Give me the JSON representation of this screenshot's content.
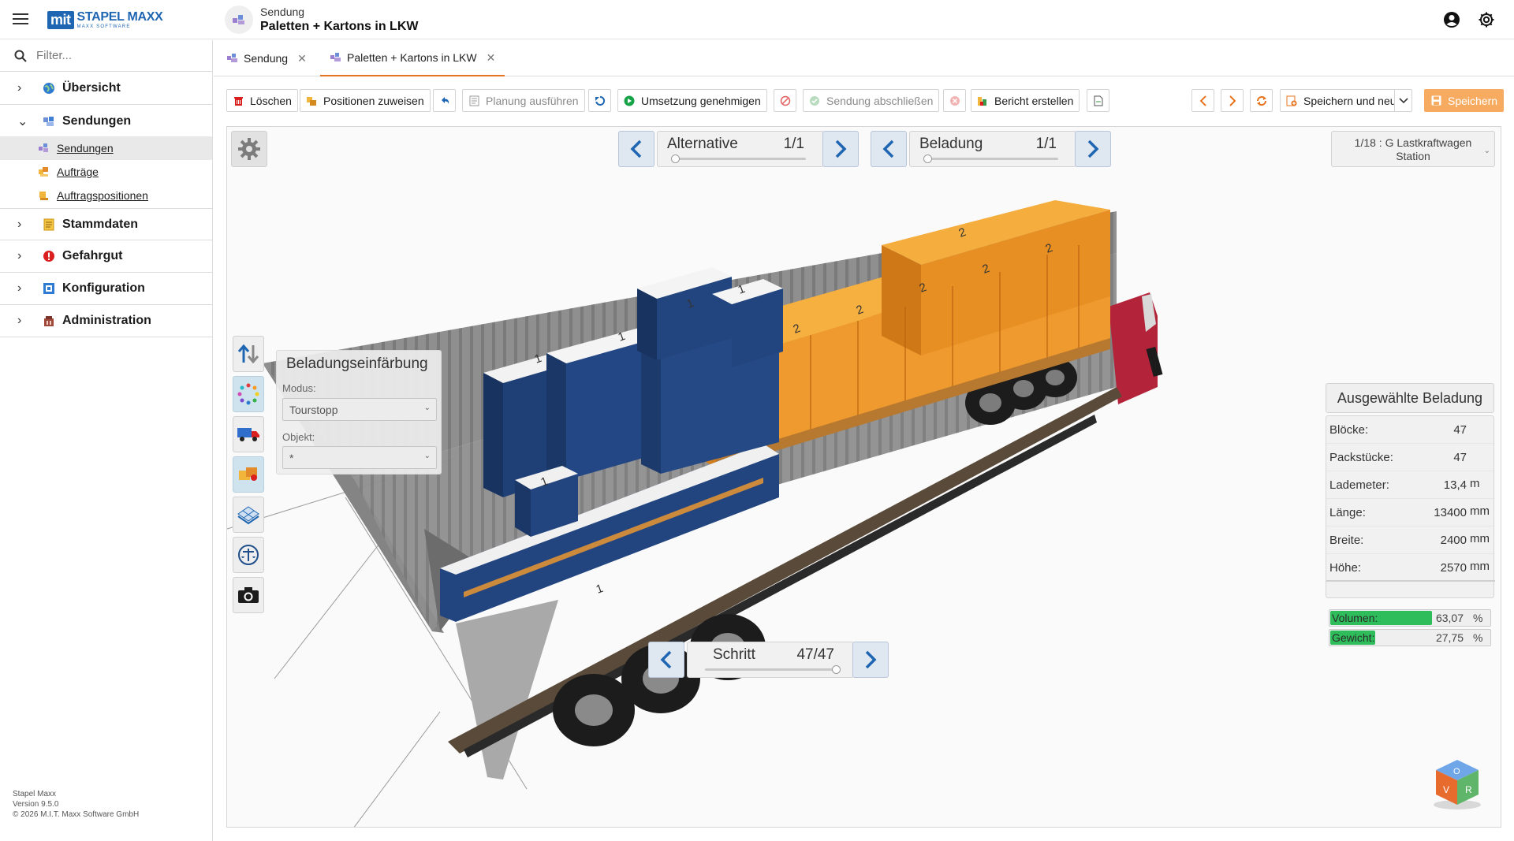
{
  "app": {
    "logo_mit": "mit",
    "logo_name": "STAPEL MAXX",
    "logo_sub": "MAXX SOFTWARE"
  },
  "header": {
    "subtitle": "Sendung",
    "title": "Paletten + Kartons in LKW"
  },
  "sidebar": {
    "filter_placeholder": "Filter...",
    "items": [
      {
        "label": "Übersicht",
        "icon": "globe-icon"
      },
      {
        "label": "Sendungen",
        "icon": "shipment-icon",
        "expanded": true
      },
      {
        "label": "Stammdaten",
        "icon": "master-data-icon"
      },
      {
        "label": "Gefahrgut",
        "icon": "hazard-icon"
      },
      {
        "label": "Konfiguration",
        "icon": "config-icon"
      },
      {
        "label": "Administration",
        "icon": "admin-icon"
      }
    ],
    "sub_items": [
      {
        "label": "Sendungen",
        "active": true
      },
      {
        "label": "Aufträge"
      },
      {
        "label": "Auftragspositionen"
      }
    ],
    "version_lines": [
      "Stapel Maxx",
      "Version 9.5.0",
      "© 2026 M.I.T. Maxx Software GmbH"
    ]
  },
  "tabs": [
    {
      "label": "Sendung",
      "active": false
    },
    {
      "label": "Paletten + Kartons in LKW",
      "active": true
    }
  ],
  "toolbar": {
    "delete": "Löschen",
    "assign": "Positionen zuweisen",
    "plan": "Planung ausführen",
    "approve": "Umsetzung genehmigen",
    "complete": "Sendung abschließen",
    "report": "Bericht erstellen",
    "save_new": "Speichern und neu",
    "save": "Speichern"
  },
  "viewer": {
    "alternative": {
      "label": "Alternative",
      "value": "1/1",
      "position": 0.0
    },
    "beladung": {
      "label": "Beladung",
      "value": "1/1",
      "position": 0.0
    },
    "schritt": {
      "label": "Schritt",
      "value": "47/47",
      "position": 1.0
    },
    "station": {
      "line1": "1/18 : G Lastkraftwagen",
      "line2": "Station"
    },
    "coloring": {
      "title": "Beladungseinfärbung",
      "mode_label": "Modus:",
      "mode_value": "Tourstopp",
      "object_label": "Objekt:",
      "object_value": "*"
    },
    "selected_title": "Ausgewählte Beladung",
    "stats": [
      {
        "key": "Blöcke:",
        "value": "47",
        "unit": ""
      },
      {
        "key": "Packstücke:",
        "value": "47",
        "unit": ""
      },
      {
        "key": "Lademeter:",
        "value": "13,4",
        "unit": "m"
      },
      {
        "key": "Länge:",
        "value": "13400",
        "unit": "mm"
      },
      {
        "key": "Breite:",
        "value": "2400",
        "unit": "mm"
      },
      {
        "key": "Höhe:",
        "value": "2570",
        "unit": "mm"
      }
    ],
    "bars": [
      {
        "key": "Volumen:",
        "value": "63,07",
        "unit": "%",
        "fraction": 0.6307
      },
      {
        "key": "Gewicht:",
        "value": "27,75",
        "unit": "%",
        "fraction": 0.2775
      }
    ],
    "scene_labels": {
      "stop1": "1",
      "stop2": "2"
    },
    "cube_labels": {
      "top": "O",
      "left": "V",
      "right": "R"
    }
  },
  "colors": {
    "accent": "#e8731e",
    "brand": "#1f66b2",
    "stop1_box": "#1e3f7a",
    "stop2_box": "#ee9426",
    "progress": "#2ebd5a"
  }
}
